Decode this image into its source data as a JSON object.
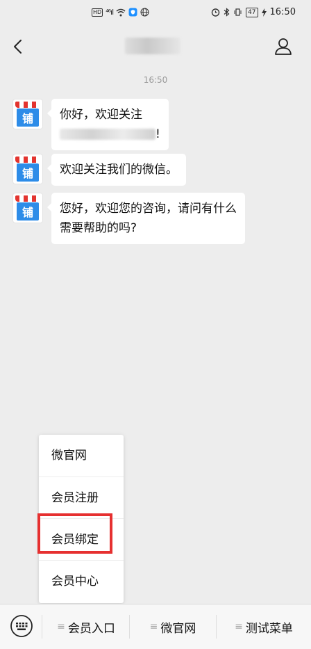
{
  "status_bar": {
    "hd": "HD",
    "signal": "⁴⁶ıl",
    "battery": "47",
    "time": "16:50"
  },
  "header": {
    "title": "",
    "back_icon": "chevron-left-icon",
    "profile_icon": "person-icon"
  },
  "chat": {
    "timestamp": "16:50",
    "avatar_text": "铺",
    "messages": [
      {
        "line1": "你好，欢迎关注",
        "line2_suffix": "!"
      },
      {
        "text": "欢迎关注我们的微信。"
      },
      {
        "line1": "您好，欢迎您的咨询，请问有什么",
        "line2": "需要帮助的吗?"
      }
    ]
  },
  "popup_menu": {
    "items": [
      "微官网",
      "会员注册",
      "会员绑定",
      "会员中心"
    ],
    "highlighted": "会员绑定"
  },
  "menu_bar": {
    "keyboard_icon": "keyboard-icon",
    "tabs": [
      "会员入口",
      "微官网",
      "测试菜单"
    ]
  },
  "colors": {
    "highlight": "#e63030",
    "background": "#ededed",
    "bubble": "#ffffff"
  }
}
